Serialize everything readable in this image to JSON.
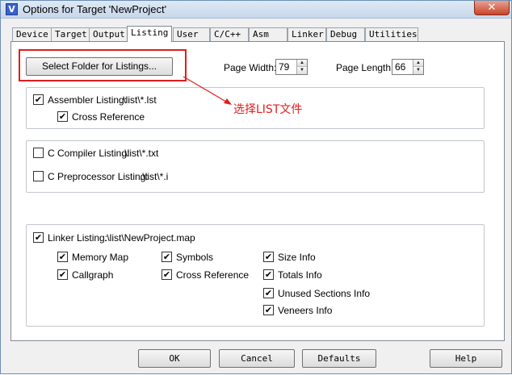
{
  "window": {
    "title": "Options for Target 'NewProject'",
    "app_icon": "V",
    "close": "✕"
  },
  "tabs": [
    {
      "label": "Device"
    },
    {
      "label": "Target"
    },
    {
      "label": "Output"
    },
    {
      "label": "Listing",
      "active": true
    },
    {
      "label": "User"
    },
    {
      "label": "C/C++"
    },
    {
      "label": "Asm"
    },
    {
      "label": "Linker"
    },
    {
      "label": "Debug"
    },
    {
      "label": "Utilities"
    }
  ],
  "listing": {
    "select_folder_label": "Select Folder for Listings...",
    "page_width_label": "Page Width:",
    "page_width_value": "79",
    "page_length_label": "Page Length:",
    "page_length_value": "66",
    "assembler": {
      "label": "Assembler Listing:",
      "path": ".\\list\\*.lst",
      "checked": true,
      "cross_reference_label": "Cross Reference",
      "cross_reference_checked": true
    },
    "c_compiler": {
      "label": "C Compiler Listing:",
      "path": ".\\list\\*.txt",
      "checked": false
    },
    "c_preprocessor": {
      "label": "C Preprocessor Listing:",
      "path": ".\\list\\*.i",
      "checked": false
    },
    "linker": {
      "label": "Linker Listing:",
      "path": ".\\list\\NewProject.map",
      "checked": true,
      "options": {
        "memory_map": {
          "label": "Memory Map",
          "checked": true
        },
        "callgraph": {
          "label": "Callgraph",
          "checked": true
        },
        "symbols": {
          "label": "Symbols",
          "checked": true
        },
        "cross_reference": {
          "label": "Cross Reference",
          "checked": true
        },
        "size_info": {
          "label": "Size Info",
          "checked": true
        },
        "totals_info": {
          "label": "Totals Info",
          "checked": true
        },
        "unused_sections_info": {
          "label": "Unused Sections Info",
          "checked": true
        },
        "veneers_info": {
          "label": "Veneers Info",
          "checked": true
        }
      }
    }
  },
  "annotation": {
    "text": "选择LIST文件",
    "color": "#e11d1d"
  },
  "footer": {
    "ok": "OK",
    "cancel": "Cancel",
    "defaults": "Defaults",
    "help": "Help"
  },
  "checkmark": "✔"
}
